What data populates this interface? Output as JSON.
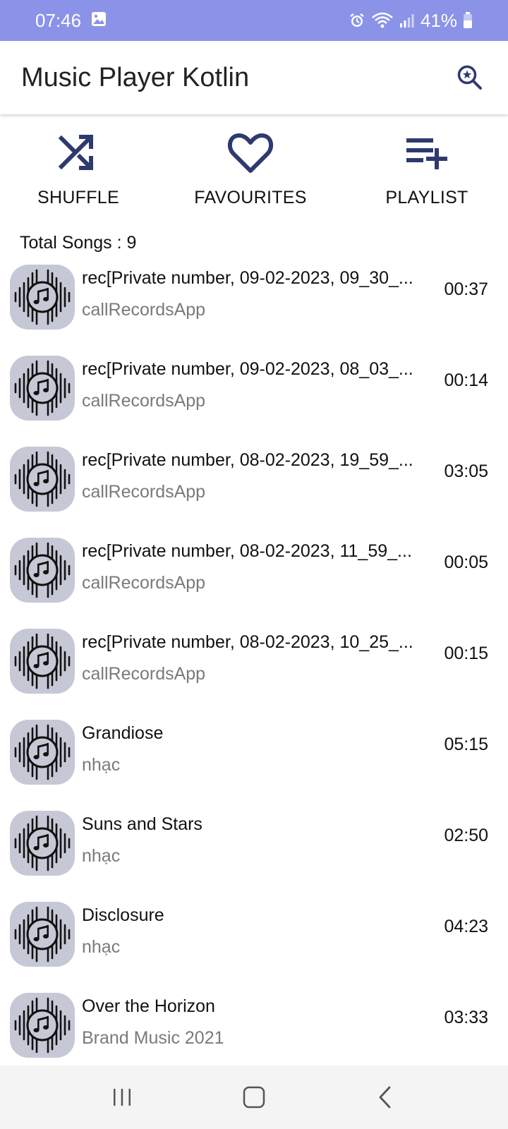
{
  "status_bar": {
    "time": "07:46",
    "battery": "41%"
  },
  "app_bar": {
    "title": "Music Player Kotlin",
    "search_icon": "search-star-icon"
  },
  "actions": [
    {
      "label": "SHUFFLE",
      "icon": "shuffle-icon"
    },
    {
      "label": "FAVOURITES",
      "icon": "heart-icon"
    },
    {
      "label": "PLAYLIST",
      "icon": "playlist-add-icon"
    }
  ],
  "total_songs": "Total Songs : 9",
  "songs": [
    {
      "title": "rec[Private number, 09-02-2023, 09_30_...",
      "artist": "callRecordsApp",
      "duration": "00:37"
    },
    {
      "title": "rec[Private number, 09-02-2023, 08_03_...",
      "artist": "callRecordsApp",
      "duration": "00:14"
    },
    {
      "title": "rec[Private number, 08-02-2023, 19_59_...",
      "artist": "callRecordsApp",
      "duration": "03:05"
    },
    {
      "title": "rec[Private number, 08-02-2023, 11_59_...",
      "artist": "callRecordsApp",
      "duration": "00:05"
    },
    {
      "title": "rec[Private number, 08-02-2023, 10_25_...",
      "artist": "callRecordsApp",
      "duration": "00:15"
    },
    {
      "title": "Grandiose",
      "artist": "nhạc",
      "duration": "05:15"
    },
    {
      "title": "Suns and Stars",
      "artist": "nhạc",
      "duration": "02:50"
    },
    {
      "title": "Disclosure",
      "artist": "nhạc",
      "duration": "04:23"
    },
    {
      "title": "Over the Horizon",
      "artist": "Brand Music 2021",
      "duration": "03:33"
    }
  ],
  "colors": {
    "status_bar": "#8b93e8",
    "accent": "#2e3a6e",
    "art_bg": "#c7c8d6"
  }
}
